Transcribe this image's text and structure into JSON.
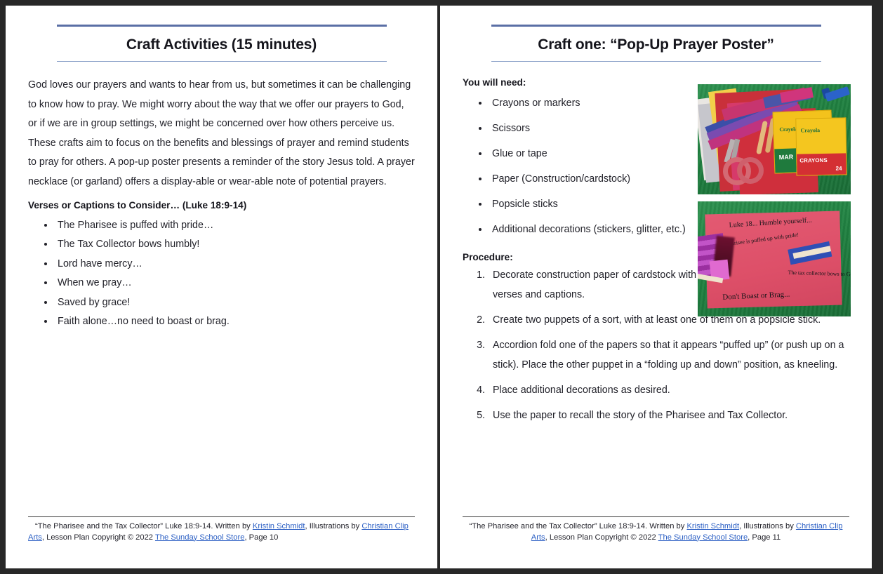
{
  "document": {
    "title": "The Pharisee and the Tax Collector — Craft Activities"
  },
  "pages": [
    {
      "title": "Craft Activities (15 minutes)",
      "paragraph": "God loves our prayers and wants to hear from us, but sometimes it can be challenging to know how to pray. We might worry about the way that we offer our prayers to God, or if we are in group settings, we might be concerned over how others perceive us. These crafts aim to focus on the benefits and blessings of prayer and remind students to pray for others.  A pop-up poster presents a reminder of the story Jesus told. A prayer necklace (or garland) offers a display-able or wear-able note of potential prayers.",
      "subhead": "Verses or Captions to Consider… (Luke 18:9-14)",
      "bullets": [
        "The Pharisee is puffed with pride…",
        "The Tax Collector bows humbly!",
        "Lord have mercy…",
        "When we pray…",
        "Saved by grace!",
        "Faith alone…no need to boast or brag."
      ],
      "footer": {
        "part1": "“The Pharisee and the Tax Collector” Luke 18:9-14.  Written by ",
        "link1": "Kristin Schmidt",
        "part2": ", Illustrations by ",
        "link2": "Christian Clip Arts",
        "part3": ", Lesson Plan Copyright © 2022 ",
        "link3": "The Sunday School Store",
        "part4": ", Page 10"
      }
    },
    {
      "title": "Craft one: “Pop-Up Prayer Poster”",
      "needs_head": "You will need:",
      "needs": [
        "Crayons or markers",
        "Scissors",
        "Glue or tape",
        "Paper (Construction/cardstock)",
        "Popsicle sticks",
        "Additional decorations (stickers, glitter, etc.)"
      ],
      "procedure_head": "Procedure:",
      "procedure": [
        "Decorate construction paper of cardstock with verses and captions.",
        "Create two puppets of a sort, with at least one of them on a popsicle stick.",
        "Accordion fold one of the papers so that it appears “puffed up” (or push up on a stick). Place the other puppet in a “folding up and down” position, as kneeling.",
        "Place additional decorations as desired.",
        "Use the paper to recall the story of the Pharisee and Tax Collector."
      ],
      "figures": [
        {
          "name": "craft-supplies-photo",
          "caption_text": "Crayola marker and crayon boxes, scissors, popsicle sticks, glue stick and colored paper strips on green felt",
          "crayola_back_label": "Crayola",
          "crayola_back_word": "MAR",
          "crayola_front_label": "Crayola",
          "crayola_front_word": "CRAYONS",
          "crayola_count": "24"
        },
        {
          "name": "finished-poster-photo",
          "handwriting": [
            "Luke 18... Humble yourself...",
            "The Pharisee is puffed up with pride!",
            "The tax collector bows to God",
            "Don't Boast or Brag..."
          ]
        }
      ],
      "footer": {
        "part1": "“The Pharisee and the Tax Collector” Luke 18:9-14.  Written by ",
        "link1": "Kristin Schmidt",
        "part2": ", Illustrations by ",
        "link2": "Christian Clip Arts",
        "part3": ", Lesson Plan Copyright © 2022 ",
        "link3": "The Sunday School Store",
        "part4": ", Page 11"
      }
    }
  ],
  "theme": {
    "rule_top_color": "#5a6fa5",
    "rule_bottom_color": "#8aa0c8",
    "link_color": "#2b5fc4",
    "text_color": "#22222a",
    "frame_color": "#272727"
  }
}
